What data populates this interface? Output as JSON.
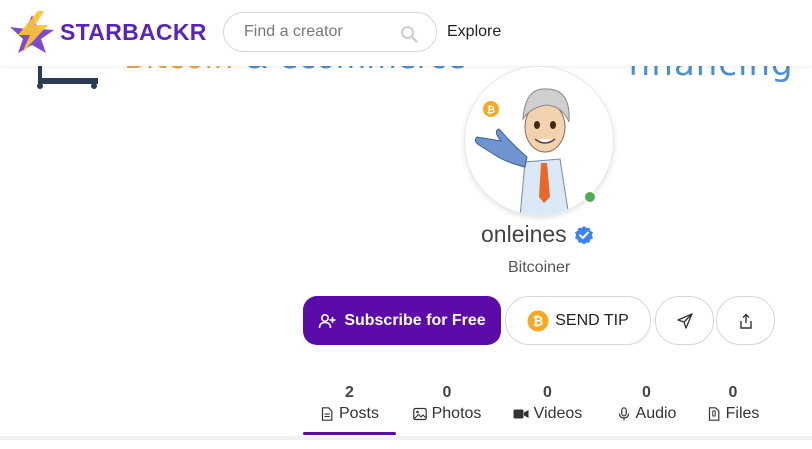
{
  "brand": {
    "name": "STARBACKR",
    "logo_icon": "lightning-star-logo"
  },
  "search": {
    "placeholder": "Find a creator",
    "value": ""
  },
  "nav": {
    "explore_label": "Explore"
  },
  "cover": {
    "left_text_a": "Bitcoin",
    "left_text_amp": "&",
    "left_text_b": "ecommerce",
    "right_text": "financing"
  },
  "profile": {
    "username": "onleines",
    "bio": "Bitcoiner",
    "verified": true,
    "online": true
  },
  "actions": {
    "subscribe_label": "Subscribe for Free",
    "tip_label": "SEND TIP"
  },
  "tabs": [
    {
      "count": "2",
      "label": "Posts",
      "icon": "document-icon",
      "active": true
    },
    {
      "count": "0",
      "label": "Photos",
      "icon": "image-icon",
      "active": false
    },
    {
      "count": "0",
      "label": "Videos",
      "icon": "video-icon",
      "active": false
    },
    {
      "count": "0",
      "label": "Audio",
      "icon": "microphone-icon",
      "active": false
    },
    {
      "count": "0",
      "label": "Files",
      "icon": "file-icon",
      "active": false
    }
  ],
  "colors": {
    "accent": "#5a0ba8",
    "brand_text": "#5a24b8",
    "online": "#4caf50",
    "verified": "#3b82f6",
    "bitcoin": "#f7a823"
  }
}
